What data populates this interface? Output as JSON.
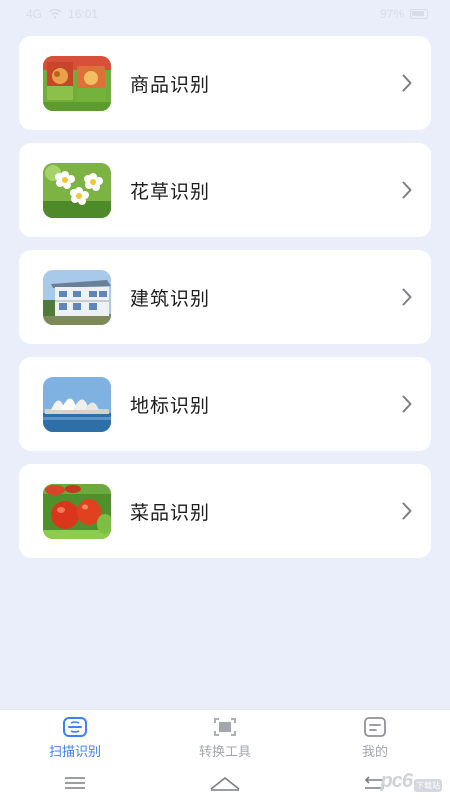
{
  "status_bar": {
    "signal": "4G",
    "time": "16:01",
    "battery": "97%"
  },
  "categories": [
    {
      "label": "商品识别",
      "icon": "product-photo"
    },
    {
      "label": "花草识别",
      "icon": "flower-photo"
    },
    {
      "label": "建筑识别",
      "icon": "building-photo"
    },
    {
      "label": "地标识别",
      "icon": "landmark-photo"
    },
    {
      "label": "菜品识别",
      "icon": "dish-photo"
    }
  ],
  "tabs": [
    {
      "label": "扫描识别",
      "icon": "scan-icon",
      "active": true
    },
    {
      "label": "转换工具",
      "icon": "convert-icon",
      "active": false
    },
    {
      "label": "我的",
      "icon": "profile-icon",
      "active": false
    }
  ],
  "watermark": {
    "text": "pc6",
    "badge": "下载站"
  },
  "colors": {
    "background": "#e9eefa",
    "card": "#ffffff",
    "accent": "#3d7fff",
    "tab_inactive": "#a3a6ad"
  }
}
